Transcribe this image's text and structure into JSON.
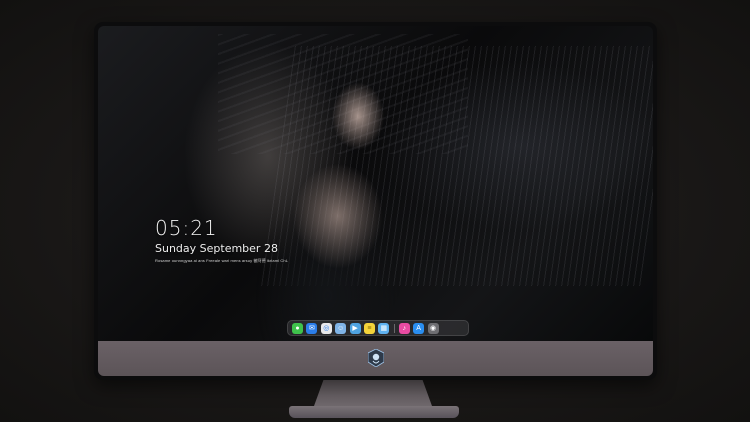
{
  "lock_screen": {
    "time": "05:21",
    "date": "Sunday September  28",
    "quote": "Rosame ounnngyaa ai ans Freeale wari mens arsuy 被阿德    ikrlaml ChL"
  },
  "dock": {
    "items": [
      {
        "name": "messages-icon",
        "color": "#3fc24c",
        "glyph": "●"
      },
      {
        "name": "mail-icon",
        "color": "#2b7de9",
        "glyph": "✉"
      },
      {
        "name": "safari-icon",
        "color": "#e8e8ea",
        "glyph": "◎"
      },
      {
        "name": "finder-icon",
        "color": "#7fb3e6",
        "glyph": "☺"
      },
      {
        "name": "imovie-icon",
        "color": "#4fa3e0",
        "glyph": "▶"
      },
      {
        "name": "notes-icon",
        "color": "#f4d33a",
        "glyph": "≡"
      },
      {
        "name": "photos-icon",
        "color": "#5fb2f0",
        "glyph": "▦"
      },
      {
        "name": "music-icon",
        "color": "#e84ba2",
        "glyph": "♪"
      },
      {
        "name": "app-store-icon",
        "color": "#2a8ef0",
        "glyph": "A"
      },
      {
        "name": "camera-icon",
        "color": "#6e6e72",
        "glyph": "◉"
      }
    ]
  },
  "colors": {
    "chin": "#5f575b",
    "bezel": "#0c0c0d",
    "background": "#1a1817"
  }
}
